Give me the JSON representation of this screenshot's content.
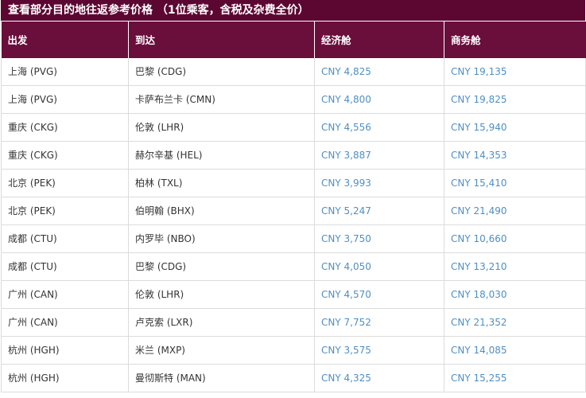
{
  "title": "查看部分目的地往返参考价格 （1位乘客，含税及杂费全价）",
  "headers": [
    "出发",
    "到达",
    "经济舱",
    "商务舱"
  ],
  "rows": [
    {
      "from": "上海 (PVG)",
      "to": "巴黎 (CDG)",
      "economy": "CNY 4,825",
      "business": "CNY 19,135"
    },
    {
      "from": "上海 (PVG)",
      "to": "卡萨布兰卡 (CMN)",
      "economy": "CNY 4,800",
      "business": "CNY 19,825"
    },
    {
      "from": "重庆 (CKG)",
      "to": "伦敦 (LHR)",
      "economy": "CNY 4,556",
      "business": "CNY 15,940"
    },
    {
      "from": "重庆 (CKG)",
      "to": "赫尔辛基 (HEL)",
      "economy": "CNY 3,887",
      "business": "CNY 14,353"
    },
    {
      "from": "北京 (PEK)",
      "to": "柏林 (TXL)",
      "economy": "CNY 3,993",
      "business": "CNY 15,410"
    },
    {
      "from": "北京 (PEK)",
      "to": "伯明翰 (BHX)",
      "economy": "CNY 5,247",
      "business": "CNY 21,490"
    },
    {
      "from": "成都 (CTU)",
      "to": "内罗毕 (NBO)",
      "economy": "CNY 3,750",
      "business": "CNY 10,660"
    },
    {
      "from": "成都 (CTU)",
      "to": "巴黎 (CDG)",
      "economy": "CNY 4,050",
      "business": "CNY 13,210"
    },
    {
      "from": "广州 (CAN)",
      "to": "伦敦 (LHR)",
      "economy": "CNY 4,570",
      "business": "CNY 18,030"
    },
    {
      "from": "广州 (CAN)",
      "to": "卢克索 (LXR)",
      "economy": "CNY 7,752",
      "business": "CNY 21,352"
    },
    {
      "from": "杭州 (HGH)",
      "to": "米兰 (MXP)",
      "economy": "CNY 3,575",
      "business": "CNY 14,085"
    },
    {
      "from": "杭州 (HGH)",
      "to": "曼彻斯特 (MAN)",
      "economy": "CNY 4,325",
      "business": "CNY 15,255"
    }
  ],
  "colors": {
    "title_bg": "#5c0632",
    "header_bg": "#6a0e3c",
    "price_text": "#4f8fc4"
  }
}
